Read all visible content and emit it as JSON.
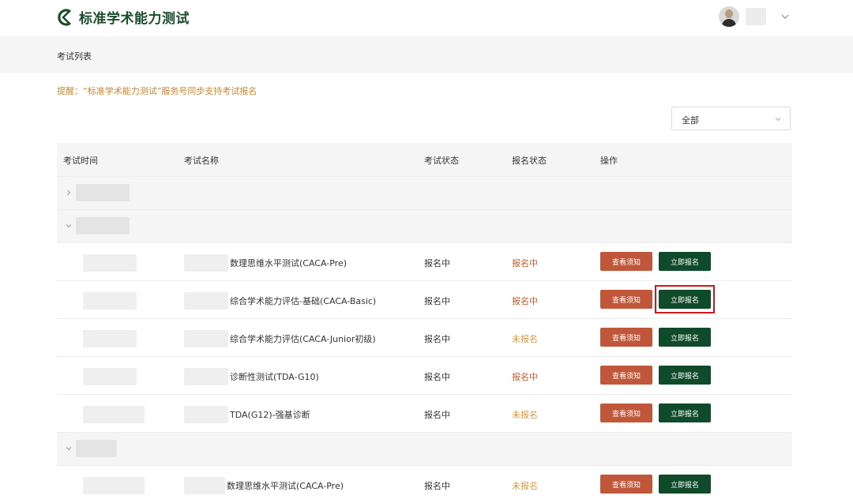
{
  "header": {
    "title": "标准学术能力测试",
    "brand_color": "#1b4d2b",
    "icons": {
      "logo": "logo-icon",
      "avatar": "avatar-icon",
      "caret": "chevron-down-icon"
    }
  },
  "breadcrumb": {
    "label": "考试列表"
  },
  "notice": {
    "text": "提醒：“标准学术能力测试”服务号同步支持考试报名",
    "color": "#c7862d"
  },
  "filter": {
    "selected": "全部"
  },
  "table": {
    "columns": [
      "考试时间",
      "考试名称",
      "考试状态",
      "报名状态",
      "操作"
    ],
    "rows": [
      {
        "name": "数理思维水平测试(CACA-Pre)",
        "exam_status": "报名中",
        "reg_status": "报名中",
        "reg_color": "#c75a2b",
        "btn_notice": "查看须知",
        "btn_apply": "立即报名"
      },
      {
        "name": "综合学术能力评估-基础(CACA-Basic)",
        "exam_status": "报名中",
        "reg_status": "报名中",
        "reg_color": "#c75a2b",
        "btn_notice": "查看须知",
        "btn_apply": "立即报名"
      },
      {
        "name": "综合学术能力评估(CACA-Junior初级)",
        "exam_status": "报名中",
        "reg_status": "未报名",
        "reg_color": "#d49a3a",
        "btn_notice": "查看须知",
        "btn_apply": "立即报名"
      },
      {
        "name": "诊断性测试(TDA-G10)",
        "exam_status": "报名中",
        "reg_status": "报名中",
        "reg_color": "#c75a2b",
        "btn_notice": "查看须知",
        "btn_apply": "立即报名"
      },
      {
        "name": "TDA(G12)-强基诊断",
        "exam_status": "报名中",
        "reg_status": "未报名",
        "reg_color": "#d49a3a",
        "btn_notice": "查看须知",
        "btn_apply": "立即报名"
      },
      {
        "name": "数理思维水平测试(CACA-Pre)",
        "exam_status": "报名中",
        "reg_status": "未报名",
        "reg_color": "#d49a3a",
        "btn_notice": "查看须知",
        "btn_apply": "立即报名"
      }
    ]
  },
  "colors": {
    "notice_button": "#c0573a",
    "apply_button": "#0f4a2a",
    "highlight": "#d11818"
  }
}
